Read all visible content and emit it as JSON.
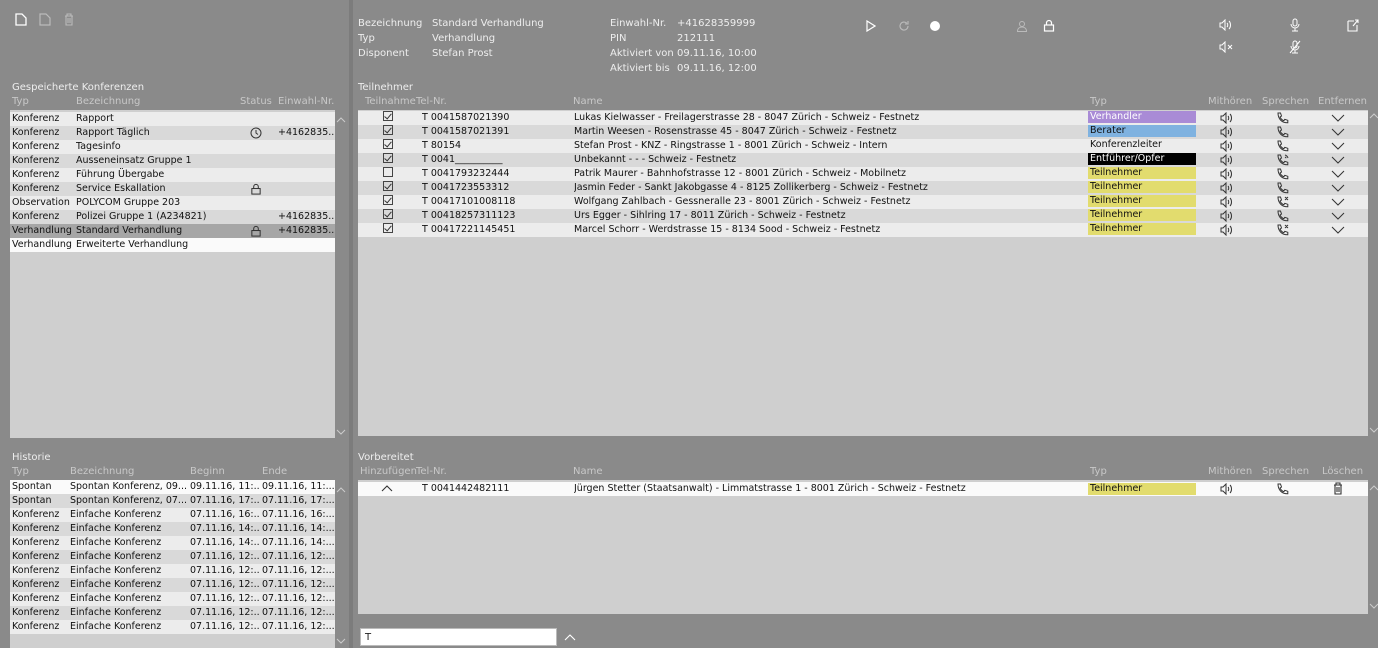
{
  "toolbar": {
    "icons": [
      "new-doc-icon",
      "edit-doc-icon",
      "trash-icon"
    ]
  },
  "saved": {
    "title": "Gespeicherte Konferenzen",
    "headers": {
      "typ": "Typ",
      "bezeichnung": "Bezeichnung",
      "status": "Status",
      "einwahl": "Einwahl-Nr."
    },
    "rows": [
      {
        "typ": "Konferenz",
        "bez": "Rapport",
        "status_icon": "",
        "einwahl": ""
      },
      {
        "typ": "Konferenz",
        "bez": "Rapport Täglich",
        "status_icon": "clock-icon",
        "einwahl": "+4162835..."
      },
      {
        "typ": "Konferenz",
        "bez": "Tagesinfo",
        "status_icon": "",
        "einwahl": ""
      },
      {
        "typ": "Konferenz",
        "bez": "Ausseneinsatz Gruppe 1",
        "status_icon": "",
        "einwahl": ""
      },
      {
        "typ": "Konferenz",
        "bez": "Führung Übergabe",
        "status_icon": "",
        "einwahl": ""
      },
      {
        "typ": "Konferenz",
        "bez": "Service Eskallation",
        "status_icon": "lock-icon",
        "einwahl": ""
      },
      {
        "typ": "Observation",
        "bez": "POLYCOM Gruppe 203",
        "status_icon": "",
        "einwahl": ""
      },
      {
        "typ": "Konferenz",
        "bez": "Polizei Gruppe 1 (A234821)",
        "status_icon": "",
        "einwahl": "+4162835..."
      },
      {
        "typ": "Verhandlung",
        "bez": "Standard Verhandlung",
        "status_icon": "lock-icon",
        "einwahl": "+4162835..."
      },
      {
        "typ": "Verhandlung",
        "bez": "Erweiterte Verhandlung",
        "status_icon": "",
        "einwahl": ""
      }
    ]
  },
  "history": {
    "title": "Historie",
    "headers": {
      "typ": "Typ",
      "bezeichnung": "Bezeichnung",
      "beginn": "Beginn",
      "ende": "Ende"
    },
    "rows": [
      {
        "typ": "Spontan",
        "bez": "Spontan Konferenz, 09....",
        "beginn": "09.11.16, 11:...",
        "ende": "09.11.16, 11:..."
      },
      {
        "typ": "Spontan",
        "bez": "Spontan Konferenz, 07....",
        "beginn": "07.11.16, 17:...",
        "ende": "07.11.16, 17:..."
      },
      {
        "typ": "Konferenz",
        "bez": "Einfache Konferenz",
        "beginn": "07.11.16, 16:...",
        "ende": "07.11.16, 16:..."
      },
      {
        "typ": "Konferenz",
        "bez": "Einfache Konferenz",
        "beginn": "07.11.16, 14:...",
        "ende": "07.11.16, 14:..."
      },
      {
        "typ": "Konferenz",
        "bez": "Einfache Konferenz",
        "beginn": "07.11.16, 14:...",
        "ende": "07.11.16, 14:..."
      },
      {
        "typ": "Konferenz",
        "bez": "Einfache Konferenz",
        "beginn": "07.11.16, 12:...",
        "ende": "07.11.16, 12:..."
      },
      {
        "typ": "Konferenz",
        "bez": "Einfache Konferenz",
        "beginn": "07.11.16, 12:...",
        "ende": "07.11.16, 12:..."
      },
      {
        "typ": "Konferenz",
        "bez": "Einfache Konferenz",
        "beginn": "07.11.16, 12:...",
        "ende": "07.11.16, 12:..."
      },
      {
        "typ": "Konferenz",
        "bez": "Einfache Konferenz",
        "beginn": "07.11.16, 12:...",
        "ende": "07.11.16, 12:..."
      },
      {
        "typ": "Konferenz",
        "bez": "Einfache Konferenz",
        "beginn": "07.11.16, 12:...",
        "ende": "07.11.16, 12:..."
      },
      {
        "typ": "Konferenz",
        "bez": "Einfache Konferenz",
        "beginn": "07.11.16, 12:...",
        "ende": "07.11.16, 12:..."
      }
    ]
  },
  "info": {
    "bezeichnung_label": "Bezeichnung",
    "bezeichnung": "Standard Verhandlung",
    "typ_label": "Typ",
    "typ": "Verhandlung",
    "disponent_label": "Disponent",
    "disponent": "Stefan Prost",
    "einwahl_label": "Einwahl-Nr.",
    "einwahl": "+41628359999",
    "pin_label": "PIN",
    "pin": "212111",
    "aktiviert_von_label": "Aktiviert von",
    "aktiviert_von": "09.11.16, 10:00",
    "aktiviert_bis_label": "Aktiviert bis",
    "aktiviert_bis": "09.11.16, 12:00"
  },
  "participants": {
    "title": "Teilnehmer",
    "headers": {
      "teilnahme": "Teilnahme",
      "tel": "Tel-Nr.",
      "name": "Name",
      "typ": "Typ",
      "mithoeren": "Mithören",
      "sprechen": "Sprechen",
      "entfernen": "Entfernen"
    },
    "rows": [
      {
        "checked": true,
        "tel": "T 0041587021390",
        "name": "Lukas Kielwasser - Freilagerstrasse 28 - 8047 Zürich - Schweiz - Festnetz",
        "typ": "Verhandler",
        "typ_bg": "#a98bd6",
        "typ_fg": "#ffffff",
        "phone": "phone-icon"
      },
      {
        "checked": true,
        "tel": "T 0041587021391",
        "name": "Martin Weesen - Rosenstrasse 45 - 8047 Zürich - Schweiz - Festnetz",
        "typ": "Berater",
        "typ_bg": "#7fb2e0",
        "typ_fg": "#111111",
        "phone": "phone-icon"
      },
      {
        "checked": true,
        "tel": "T 80154",
        "name": "Stefan Prost - KNZ - Ringstrasse 1 - 8001 Zürich - Schweiz - Intern",
        "typ": "Konferenzleiter",
        "typ_bg": "transparent",
        "typ_fg": "#111111",
        "phone": "phone-icon"
      },
      {
        "checked": true,
        "tel": "T 0041__________",
        "name": "Unbekannt - - - Schweiz - Festnetz",
        "typ": "Entführer/Opfer",
        "typ_bg": "#000000",
        "typ_fg": "#ffffff",
        "phone": "phone-wave-icon"
      },
      {
        "checked": false,
        "tel": "T 0041793232444",
        "name": "Patrik Maurer - Bahnhofstrasse 12 - 8001 Zürich - Schweiz - Mobilnetz",
        "typ": "Teilnehmer",
        "typ_bg": "#e2dc6e",
        "typ_fg": "#111111",
        "phone": "phone-icon"
      },
      {
        "checked": true,
        "tel": "T 0041723553312",
        "name": "Jasmin Feder - Sankt Jakobgasse 4 - 8125 Zollikerberg - Schweiz - Festnetz",
        "typ": "Teilnehmer",
        "typ_bg": "#e2dc6e",
        "typ_fg": "#111111",
        "phone": "phone-icon"
      },
      {
        "checked": true,
        "tel": "T 00417101008118",
        "name": "Wolfgang Zahlbach - Gessneralle 23 - 8001 Zürich - Schweiz - Festnetz",
        "typ": "Teilnehmer",
        "typ_bg": "#e2dc6e",
        "typ_fg": "#111111",
        "phone": "phone-muted-icon"
      },
      {
        "checked": true,
        "tel": "T 00418257311123",
        "name": "Urs Egger - Sihlring 17 - 8011 Zürich - Schweiz - Festnetz",
        "typ": "Teilnehmer",
        "typ_bg": "#e2dc6e",
        "typ_fg": "#111111",
        "phone": "phone-icon"
      },
      {
        "checked": true,
        "tel": "T 00417221145451",
        "name": "Marcel Schorr - Werdstrasse 15 - 8134 Sood - Schweiz - Festnetz",
        "typ": "Teilnehmer",
        "typ_bg": "#e2dc6e",
        "typ_fg": "#111111",
        "phone": "phone-muted-icon"
      }
    ]
  },
  "prepared": {
    "title": "Vorbereitet",
    "headers": {
      "hinzufuegen": "Hinzufügen",
      "tel": "Tel-Nr.",
      "name": "Name",
      "typ": "Typ",
      "mithoeren": "Mithören",
      "sprechen": "Sprechen",
      "loeschen": "Löschen"
    },
    "rows": [
      {
        "tel": "T 0041442482111",
        "name": "Jürgen Stetter (Staatsanwalt) - Limmatstrasse 1 - 8001 Zürich - Schweiz - Festnetz",
        "typ": "Teilnehmer",
        "typ_bg": "#e2dc6e"
      }
    ]
  },
  "search": {
    "value": "T"
  }
}
